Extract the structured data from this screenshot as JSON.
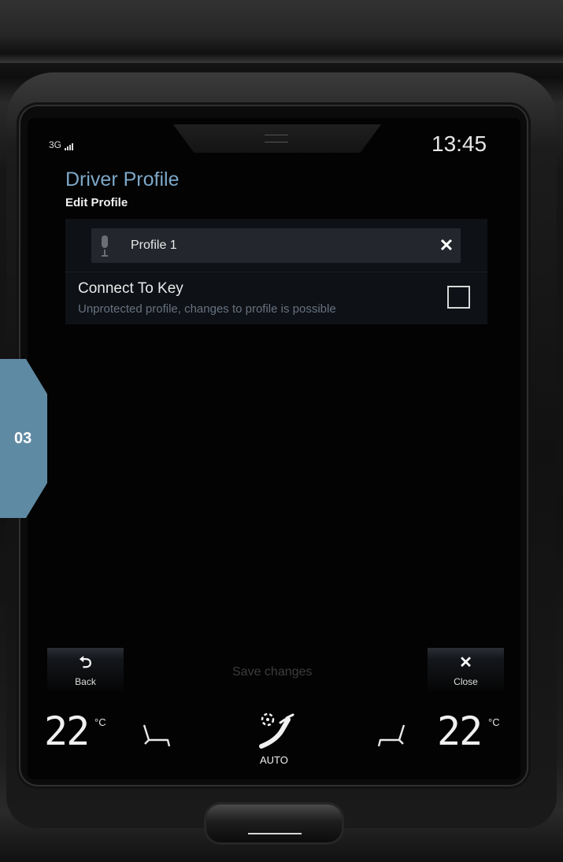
{
  "chapter": {
    "label": "03"
  },
  "status_bar": {
    "network": "3G",
    "time": "13:45"
  },
  "header": {
    "title": "Driver Profile",
    "subtitle": "Edit Profile"
  },
  "profile_name": {
    "value": "Profile 1"
  },
  "connect_to_key": {
    "label": "Connect To Key",
    "description": "Unprotected profile, changes to profile is possible",
    "checked": false
  },
  "actions": {
    "back_label": "Back",
    "save_label": "Save changes",
    "close_label": "Close"
  },
  "climate": {
    "left_temp": "22",
    "right_temp": "22",
    "unit": "°C",
    "mode": "AUTO",
    "icons": [
      "seat-heat-left-icon",
      "fan-airflow-icon",
      "seat-heat-right-icon"
    ]
  },
  "colors": {
    "title_accent": "#7da7c7",
    "chapter_tab": "#5f8aa4"
  }
}
